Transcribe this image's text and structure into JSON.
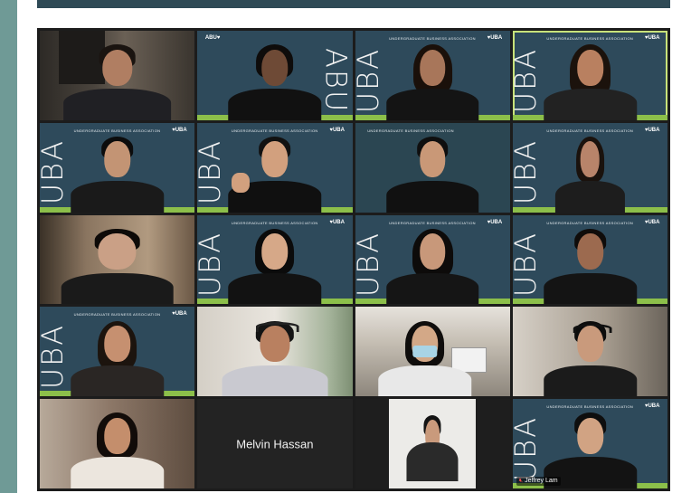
{
  "meeting": {
    "colors": {
      "accent": "#8cbf4a",
      "backdrop": "#2e4a5b",
      "active_outline": "#c8e27a"
    },
    "backdrop": {
      "header": "UNDERGRADUATE BUSINESS ASSOCIATION",
      "logo": "♥UBA",
      "logo_alt": "ABU♥",
      "vertical_text": "UBA",
      "vertical_text_alt": "ABU"
    },
    "participants": [
      {
        "id": "p1",
        "kind": "room"
      },
      {
        "id": "p2",
        "kind": "uba-mirrored"
      },
      {
        "id": "p3",
        "kind": "uba-mirrored-right"
      },
      {
        "id": "p4",
        "kind": "uba",
        "active": true
      },
      {
        "id": "p5",
        "kind": "uba"
      },
      {
        "id": "p6",
        "kind": "uba"
      },
      {
        "id": "p7",
        "kind": "uba-plain"
      },
      {
        "id": "p8",
        "kind": "uba"
      },
      {
        "id": "p9",
        "kind": "room"
      },
      {
        "id": "p10",
        "kind": "uba"
      },
      {
        "id": "p11",
        "kind": "uba"
      },
      {
        "id": "p12",
        "kind": "uba"
      },
      {
        "id": "p13",
        "kind": "uba"
      },
      {
        "id": "p14",
        "kind": "room"
      },
      {
        "id": "p15",
        "kind": "room"
      },
      {
        "id": "p16",
        "kind": "room"
      },
      {
        "id": "p17",
        "kind": "room"
      },
      {
        "id": "p18",
        "kind": "no-video",
        "name": "Melvin Hassan"
      },
      {
        "id": "p19",
        "kind": "photo"
      },
      {
        "id": "p20",
        "kind": "uba",
        "name_tag": "Jeffrey Lam",
        "muted": true
      }
    ]
  }
}
